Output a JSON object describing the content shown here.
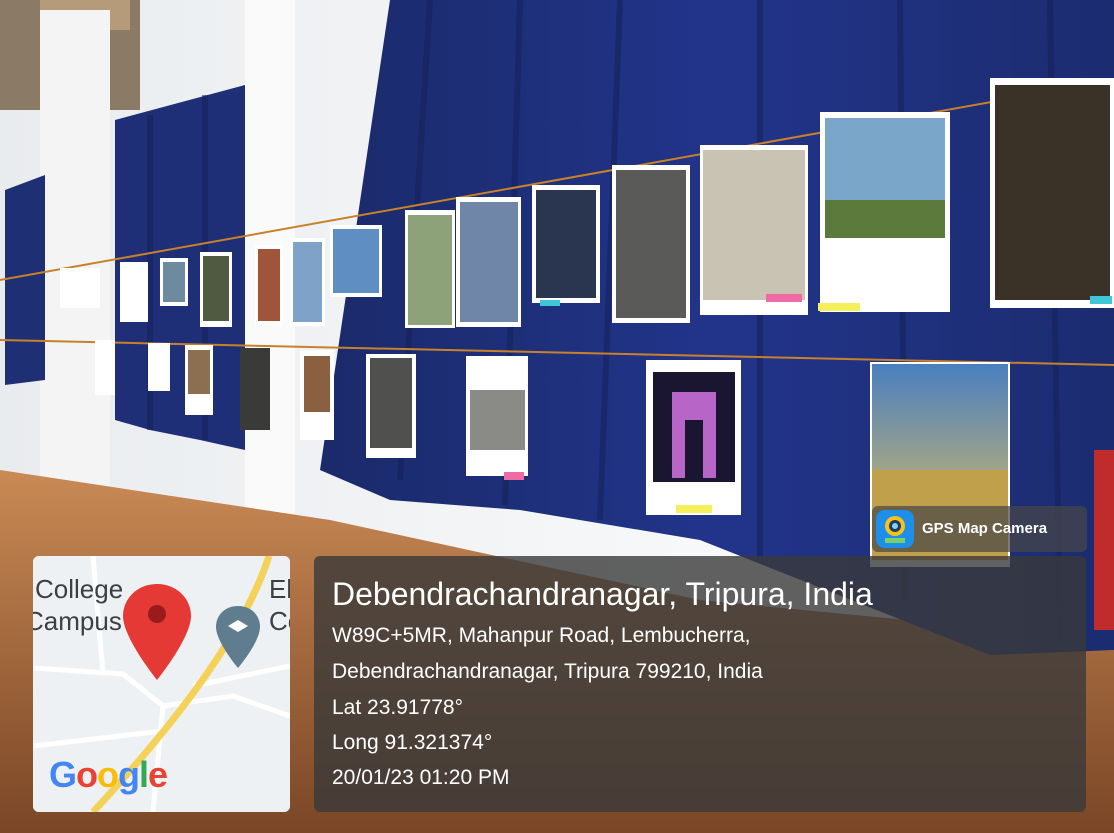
{
  "map": {
    "label_college": "College",
    "label_campus": "Campus",
    "label_right_1": "El",
    "label_right_2": "Co",
    "google_logo": [
      "G",
      "o",
      "o",
      "g",
      "l",
      "e"
    ],
    "google_colors": [
      "#4285f4",
      "#ea4335",
      "#fbbc05",
      "#4285f4",
      "#34a853",
      "#ea4335"
    ],
    "pin_color": "#e53935",
    "school_pin_color": "#5f7d8e"
  },
  "badge": {
    "label": "GPS Map Camera",
    "icon": "gps-map-camera-icon"
  },
  "location": {
    "title": "Debendrachandranagar, Tripura, India",
    "address_line_1": "W89C+5MR, Mahanpur Road, Lembucherra,",
    "address_line_2": "Debendrachandranagar, Tripura 799210, India",
    "latitude": "Lat 23.91778°",
    "longitude": "Long 91.321374°",
    "timestamp": "20/01/23 01:20 PM"
  }
}
